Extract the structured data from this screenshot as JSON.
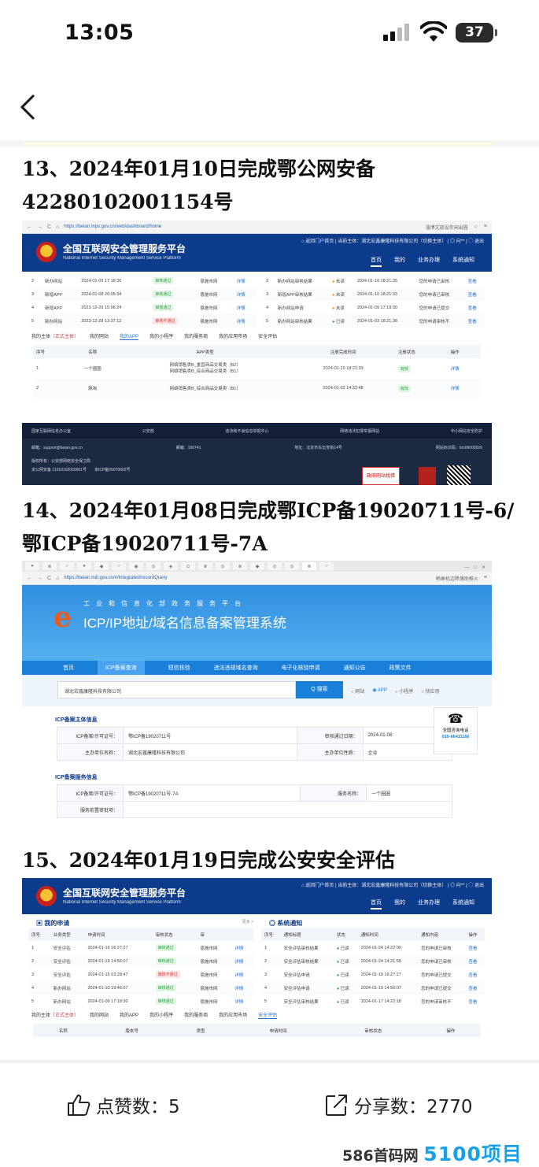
{
  "status": {
    "time": "13:05",
    "battery": "37"
  },
  "sections": [
    {
      "heading_line1": "13、2024年01月10日完成鄂公网安备",
      "heading_line2": "42280102001154号"
    },
    {
      "heading_line1": "14、2024年01月08日完成鄂ICP备19020711号-6/",
      "heading_line2": "鄂ICP备19020711号-7A"
    },
    {
      "heading_line1": "15、2024年01月19日完成公安安全评估"
    }
  ],
  "shot1": {
    "url": "https://beian.mps.gov.cn/web/dashboard/home",
    "search": "淄博文旅设宗闲出圈",
    "site_title": "全国互联网安全管理服务平台",
    "site_subtitle": "National Internet Security Management Service Platform",
    "top_right": "⌂ 返回门户首页 | 当前主体：湖北宏鑫康隆科技有限公司（切换主体） | ◎ 向** | ◯ 退出",
    "nav": [
      "首页",
      "我的",
      "业务办理",
      "系统通知"
    ],
    "apply_rows": [
      [
        "2",
        "新办网站",
        "2024-01-09 17:18:30",
        "审核通过",
        "恩施市网",
        "详情"
      ],
      [
        "3",
        "新增APP",
        "2024-01-08 20:05:34",
        "审核通过",
        "恩施市网",
        "详情"
      ],
      [
        "4",
        "新增APP",
        "2023-12-29 15:06:24",
        "审核通过",
        "恩施市网",
        "详情"
      ],
      [
        "5",
        "新办网站",
        "2023-12-28 13:37:12",
        "审核不通过",
        "恩施市网",
        "详情"
      ]
    ],
    "notice_rows": [
      [
        "2",
        "新办网站审核结果",
        "未读",
        "2024-01-10 18:21:35",
        "您的申请已审核",
        "查看"
      ],
      [
        "3",
        "新增APP审核结果",
        "未读",
        "2024-01-10 18:21:33",
        "您的申请已审核",
        "查看"
      ],
      [
        "4",
        "新办网站申请",
        "未读",
        "2024-01-09 17:18:30",
        "您的申请已提交",
        "查看"
      ],
      [
        "5",
        "新办网站审核结果",
        "已读",
        "2024-01-03 18:21:38",
        "您的申请审核不",
        "查看"
      ]
    ],
    "subtabs": [
      "我的主体",
      "（正式主体）",
      "我的网站",
      "我的APP",
      "我的小程序",
      "我的服务商",
      "我的应用市场",
      "安全评估"
    ],
    "app_headers": [
      "序号",
      "名称",
      "APP类型",
      "注册完成时间",
      "注册状态",
      "操作"
    ],
    "app_rows": [
      [
        "1",
        "一个圈圈",
        "网络销售类B_垂直商品交易类（B2）",
        "网络销售类B_综合商品交易类（B1）",
        "2024-01-10 18:21:33",
        "有效",
        "详情"
      ],
      [
        "2",
        "脉淘",
        "网络销售类B_综合商品交易类（B1）",
        "",
        "2024-01-02 14:22:48",
        "有效",
        "详情"
      ]
    ],
    "footer_links": [
      "国家互联网信息办公室",
      "公安部",
      "违法和不良信息举报中心",
      "网络违法犯罪举报网站",
      "中小网站安全防护"
    ],
    "footer_email": "邮箱：support@beian.gov.cn",
    "footer_zip": "邮编：100741",
    "footer_addr": "地址：北京市东长安街14号",
    "footer_icp": "网站标识码：bm09000026",
    "footer_owner": "版权所有：公安部网络安全保卫局",
    "footer_gongan": "京公网安备 11010102000001号",
    "footer_jicp": "京ICP备05070602号",
    "badge_gov": "政府网站找错"
  },
  "shot2": {
    "url": "https://beian.miit.gov.cn/#/Integrated/recordQuery",
    "search": "韩衰机边降落助推火",
    "banner_line1": "工业和信息化部政务服务平台",
    "banner_line2": "ICP/IP地址/域名信息备案管理系统",
    "nav": [
      "首页",
      "ICP备案查询",
      "短信核验",
      "违法违规域名查询",
      "电子化核验申请",
      "通知公告",
      "政策文件"
    ],
    "query": "湖北宏鑫康隆科技有限公司",
    "search_btn": "Q 搜索",
    "options": [
      "网站",
      "APP",
      "小程序",
      "快应用"
    ],
    "sec1": "ICP备案主体信息",
    "k_license": "ICP备案/许可证号：",
    "v_license": "鄂ICP备19020711号",
    "k_date": "审核通过日期：",
    "v_date": "2024-01-08",
    "k_org": "主办单位名称：",
    "v_org": "湖北宏鑫康隆科技有限公司",
    "k_type": "主办单位性质：",
    "v_type": "企业",
    "sec2": "ICP备案服务信息",
    "k_license2": "ICP备案/许可证号：",
    "v_license2": "鄂ICP备19020711号-7A",
    "k_service": "服务名称：",
    "v_service": "一个圈圈",
    "k_pre": "服务前置审批项：",
    "phone_title": "全国咨询电话",
    "phone": "010-66411166"
  },
  "shot3": {
    "my_apply": "我的申请",
    "more": "更多 >",
    "sys_notice": "系统通知",
    "apply_headers": [
      "序号",
      "业务类型",
      "申请时间",
      "审核状态",
      "审"
    ],
    "apply_rows": [
      [
        "1",
        "安全评估",
        "2024-01-19 16:27:27",
        "审核通过",
        "恩施市网",
        "详情"
      ],
      [
        "2",
        "安全评估",
        "2024-01-19 14:56:07",
        "审核通过",
        "恩施市网",
        "详情"
      ],
      [
        "3",
        "安全评估",
        "2024-01-15 03:28:47",
        "审核不通过",
        "恩施市网",
        "详情"
      ],
      [
        "4",
        "新办网站",
        "2024-01-10 19:46:07",
        "审核通过",
        "恩施市网",
        "详情"
      ],
      [
        "5",
        "新办网站",
        "2024-01-09 17:18:30",
        "审核通过",
        "恩施市网",
        "详情"
      ]
    ],
    "notice_headers": [
      "序号",
      "通知标题",
      "状态",
      "通知时间",
      "通知内容",
      "操作"
    ],
    "notice_rows": [
      [
        "1",
        "安全评估审核结果",
        "已读",
        "2024-01-24 14:22:00",
        "您的申请已审核",
        "查看"
      ],
      [
        "2",
        "安全评估审核结果",
        "已读",
        "2024-01-24 14:21:58",
        "您的申请已审核",
        "查看"
      ],
      [
        "3",
        "安全评估申请",
        "已读",
        "2024-01-19 16:27:27",
        "您的申请已提交",
        "查看"
      ],
      [
        "4",
        "安全评估申请",
        "已读",
        "2024-01-19 14:56:07",
        "您的申请已提交",
        "查看"
      ],
      [
        "5",
        "安全评估审核结果",
        "已读",
        "2024-01-17 14:22:18",
        "您的申请审核不",
        "查看"
      ]
    ],
    "bottom_headers": [
      "名称",
      "版本号",
      "类型",
      "申请时间",
      "审核状态",
      "操作"
    ]
  },
  "stats": {
    "likes": "点赞数：5",
    "shares": "分享数：2770"
  },
  "watermark": {
    "prefix": "586首码网",
    "brand": "5100项目网"
  }
}
